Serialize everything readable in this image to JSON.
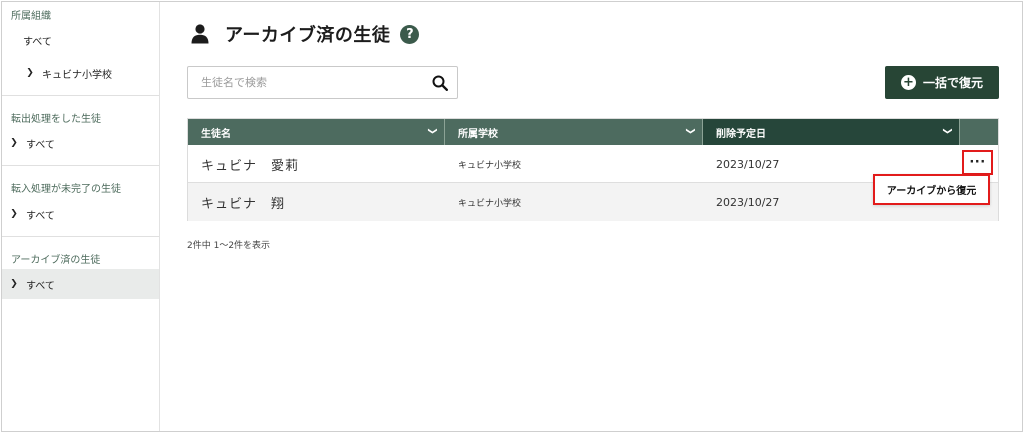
{
  "sidebar": {
    "sections": [
      {
        "heading": "所属組織",
        "items": [
          {
            "label": "すべて",
            "chevron": false
          },
          {
            "label": "キュビナ小学校",
            "chevron": true
          }
        ]
      },
      {
        "heading": "転出処理をした生徒",
        "items": [
          {
            "label": "すべて",
            "chevron": true
          }
        ]
      },
      {
        "heading": "転入処理が未完了の生徒",
        "items": [
          {
            "label": "すべて",
            "chevron": true
          }
        ]
      },
      {
        "heading": "アーカイブ済の生徒",
        "items": [
          {
            "label": "すべて",
            "chevron": true,
            "active": true
          }
        ]
      }
    ]
  },
  "header": {
    "title": "アーカイブ済の生徒",
    "icon": "person-icon",
    "help_icon": "question-icon",
    "help_glyph": "?"
  },
  "search": {
    "placeholder": "生徒名で検索",
    "value": "",
    "icon": "search-icon"
  },
  "bulk_button": {
    "label": "一括で復元",
    "icon": "plus-circle-icon",
    "icon_glyph": "+"
  },
  "table": {
    "columns": [
      "生徒名",
      "所属学校",
      "削除予定日"
    ],
    "rows": [
      {
        "name": "キュビナ　愛莉",
        "school": "キュビナ小学校",
        "date": "2023/10/27"
      },
      {
        "name": "キュビナ　翔",
        "school": "キュビナ小学校",
        "date": "2023/10/27"
      }
    ],
    "more_glyph": "···"
  },
  "context_menu": {
    "restore_label": "アーカイブから復元"
  },
  "pagination": {
    "summary": "2件中 1〜2件を表示"
  },
  "colors": {
    "brand_dark": "#274535",
    "header_bg": "#4d6b5f",
    "sorted_header_bg": "#26463a",
    "highlight": "#e21b1b"
  }
}
